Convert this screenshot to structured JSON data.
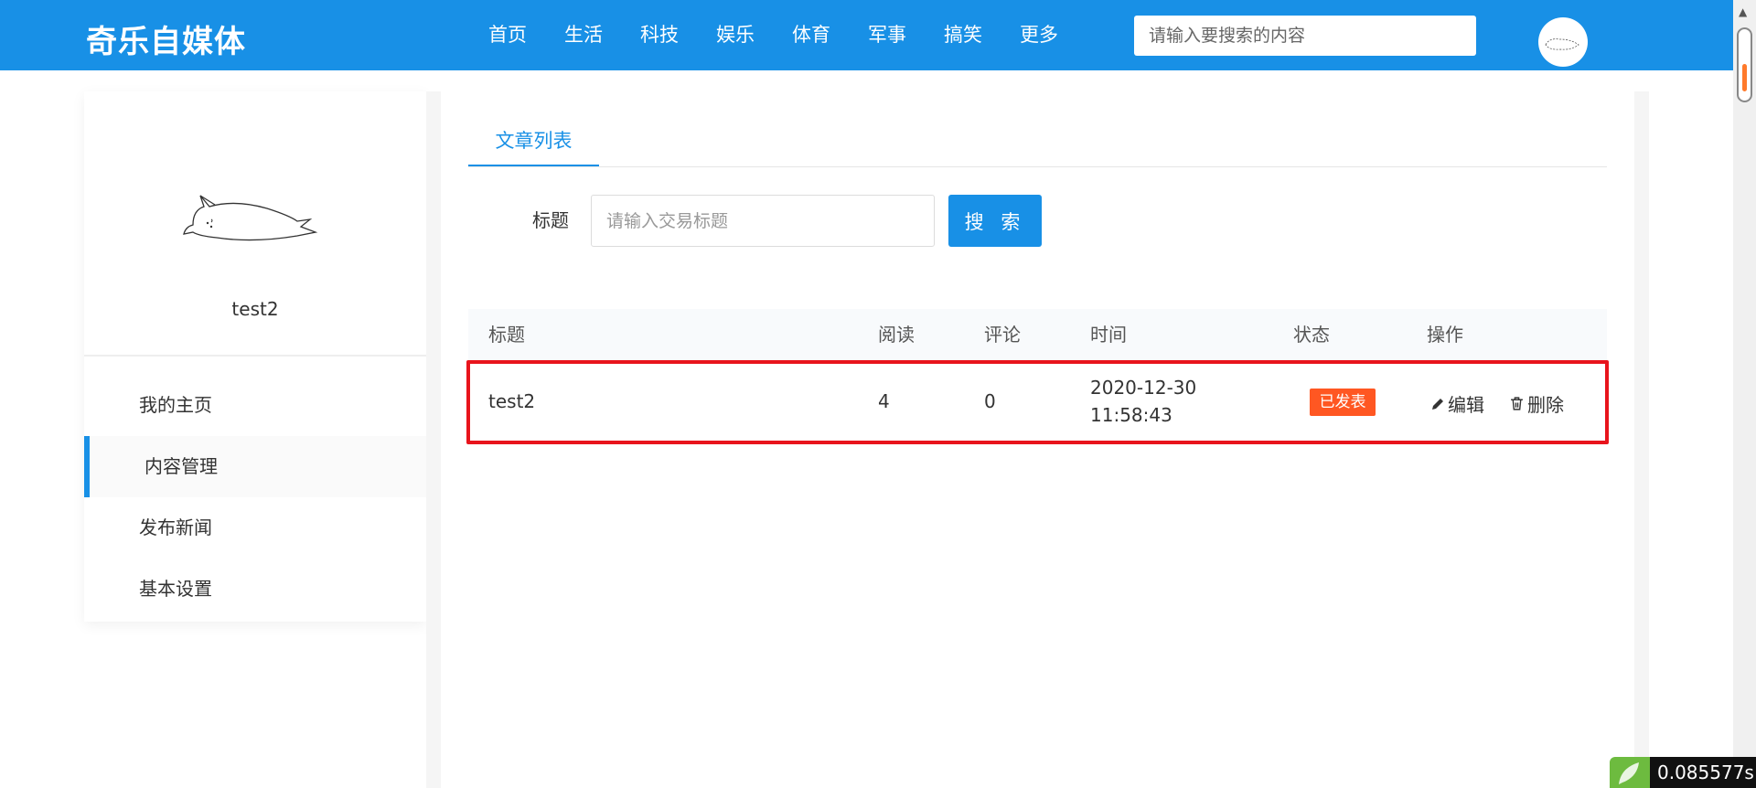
{
  "header": {
    "logo": "奇乐自媒体",
    "nav": [
      "首页",
      "生活",
      "科技",
      "娱乐",
      "体育",
      "军事",
      "搞笑",
      "更多"
    ],
    "search_placeholder": "请输入要搜索的内容"
  },
  "sidebar": {
    "username": "test2",
    "menu": [
      "我的主页",
      "内容管理",
      "发布新闻",
      "基本设置"
    ],
    "active_index": 1
  },
  "main": {
    "tab": "文章列表",
    "filter": {
      "label": "标题",
      "placeholder": "请输入交易标题",
      "button": "搜 索"
    },
    "table": {
      "columns": [
        "标题",
        "阅读",
        "评论",
        "时间",
        "状态",
        "操作"
      ],
      "rows": [
        {
          "title": "test2",
          "reads": "4",
          "comments": "0",
          "date": "2020-12-30",
          "time": "11:58:43",
          "status": "已发表",
          "edit": "编辑",
          "delete": "删除"
        }
      ]
    }
  },
  "timer": "0.085577s",
  "colors": {
    "primary": "#1890e6",
    "status": "#ff5722",
    "highlight_border": "#e8141c"
  }
}
